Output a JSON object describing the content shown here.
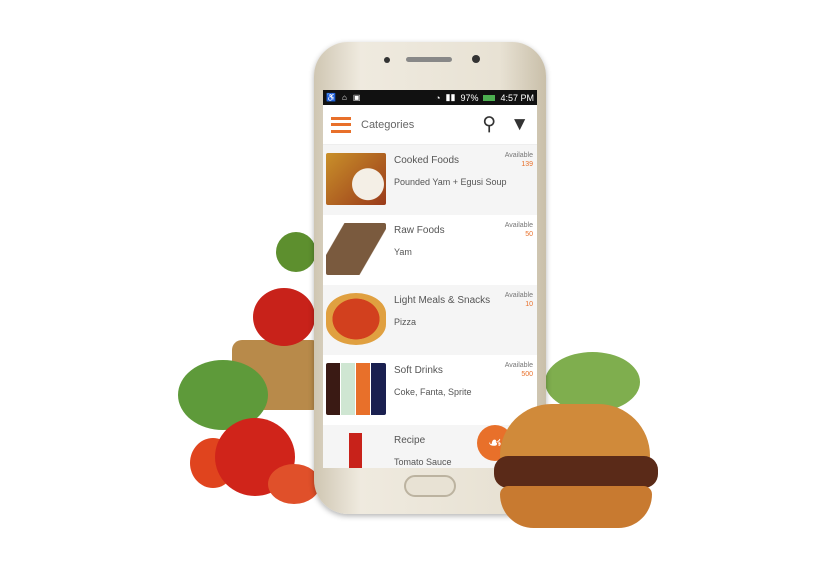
{
  "status_bar": {
    "battery": "97%",
    "time": "4:57 PM"
  },
  "app_bar": {
    "title": "Categories",
    "icons": [
      "hamburger-menu-icon",
      "search-icon",
      "filter-icon"
    ]
  },
  "categories": [
    {
      "name": "Cooked Foods",
      "item": "Pounded Yam + Egusi Soup",
      "available_label": "Available",
      "count": "139"
    },
    {
      "name": "Raw Foods",
      "item": "Yam",
      "available_label": "Available",
      "count": "50"
    },
    {
      "name": "Light Meals & Snacks",
      "item": "Pizza",
      "available_label": "Available",
      "count": "10"
    },
    {
      "name": "Soft Drinks",
      "item": "Coke, Fanta, Sprite",
      "available_label": "Available",
      "count": "500"
    },
    {
      "name": "Recipe",
      "item": "Tomato Sauce"
    }
  ],
  "fab": {
    "icon": "food-tray-icon"
  },
  "colors": {
    "accent": "#e8702a"
  }
}
